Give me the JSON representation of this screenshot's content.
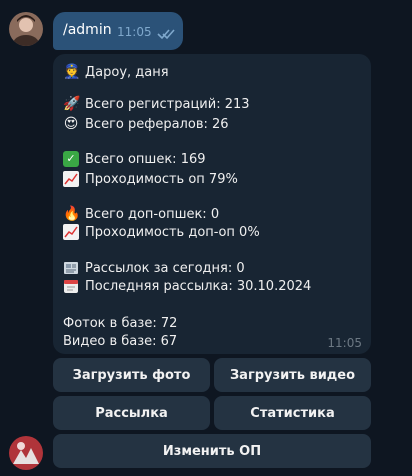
{
  "outgoing": {
    "text": "/admin",
    "time": "11:05"
  },
  "incoming": {
    "greeting": "Дароу, даня",
    "lines": [
      "Всего регистраций: 213",
      "Всего рефералов: 26",
      "Всего опшек: 169",
      "Проходимость оп 79%",
      "Всего доп-опшек: 0",
      "Проходимость доп-оп 0%",
      "Рассылок за сегодня: 0",
      "Последняя рассылка: 30.10.2024",
      "Фоток в базе: 72",
      "Видео в базе: 67"
    ],
    "time": "11:05"
  },
  "keyboard": {
    "upload_photo": "Загрузить фото",
    "upload_video": "Загрузить видео",
    "broadcast": "Рассылка",
    "statistics": "Статистика",
    "change_op": "Изменить ОП"
  },
  "icons": {
    "greeting": "police-officer-icon",
    "registrations": "rocket-icon",
    "referrals": "heart-eyes-icon",
    "op": "check-mark-icon",
    "op_rate": "chart-up-icon",
    "extra_op": "fire-icon",
    "extra_op_rate": "chart-up-icon",
    "broadcasts_today": "newspaper-icon",
    "last_broadcast": "calendar-icon"
  },
  "colors": {
    "background": "#0e1621",
    "outgoing_bubble": "#2b5278",
    "incoming_bubble": "#182533",
    "keyboard_button": "#243342"
  }
}
